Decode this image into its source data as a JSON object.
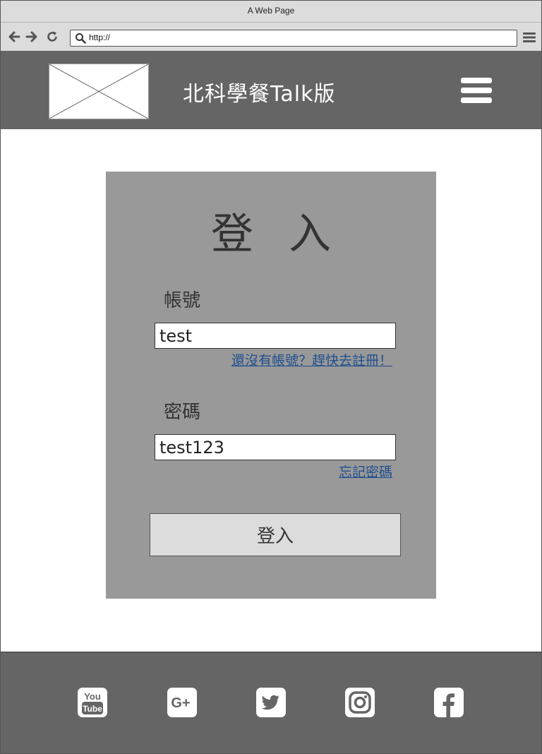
{
  "browser": {
    "window_title": "A Web Page",
    "url": "http://"
  },
  "header": {
    "site_title": "北科學餐Talk版"
  },
  "login": {
    "title": "登入",
    "account_label": "帳號",
    "account_value": "test",
    "register_link": "還沒有帳號？趕快去註冊！",
    "password_label": "密碼",
    "password_value": "test123",
    "forgot_link": "忘記密碼",
    "submit_label": "登入"
  },
  "footer": {
    "social_icons": [
      "youtube-icon",
      "google-plus-icon",
      "twitter-icon",
      "instagram-icon",
      "facebook-icon"
    ]
  },
  "colors": {
    "header_bg": "#656565",
    "card_bg": "#999999",
    "button_bg": "#dcdcdc",
    "link": "#1f4f8f"
  }
}
